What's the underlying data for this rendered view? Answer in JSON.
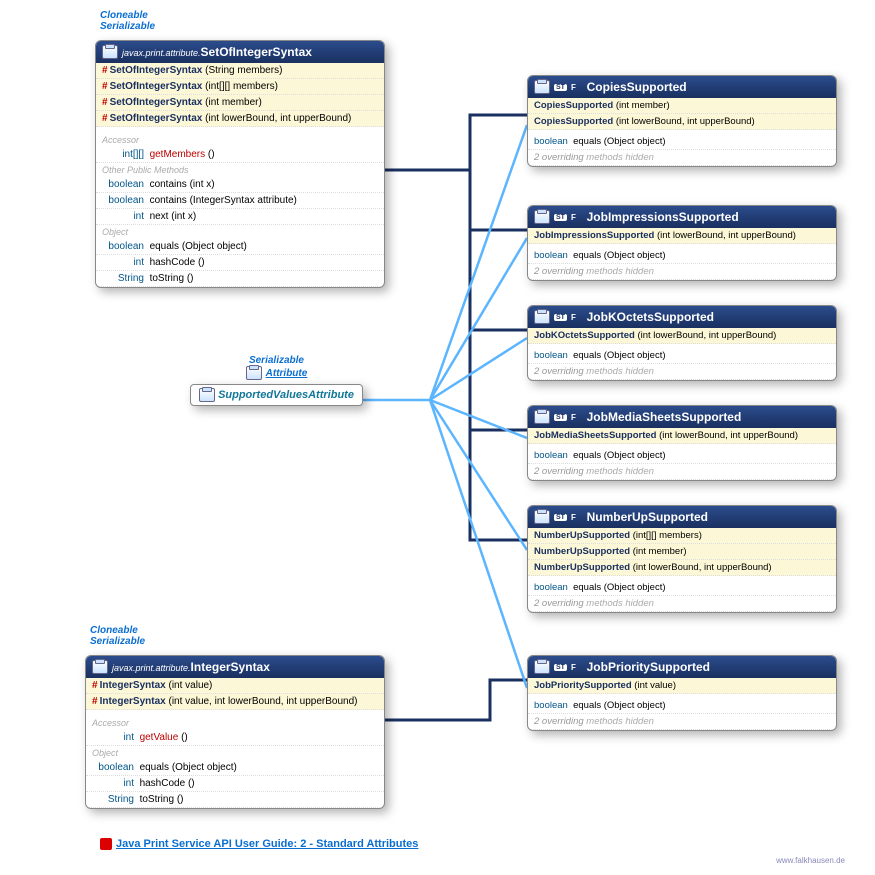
{
  "annot": {
    "cloneable": "Cloneable",
    "serializable": "Serializable",
    "attribute": "Attribute"
  },
  "setOfIntegerSyntax": {
    "pkg": "javax.print.attribute.",
    "title": "SetOfIntegerSyntax",
    "ctors": [
      {
        "name": "SetOfIntegerSyntax",
        "params": "(String members)"
      },
      {
        "name": "SetOfIntegerSyntax",
        "params": "(int[][] members)"
      },
      {
        "name": "SetOfIntegerSyntax",
        "params": "(int member)"
      },
      {
        "name": "SetOfIntegerSyntax",
        "params": "(int lowerBound, int upperBound)"
      }
    ],
    "groups": {
      "accessor": "Accessor",
      "otherPublic": "Other Public Methods",
      "object": "Object"
    },
    "accessor": {
      "ret": "int[][]",
      "name": "getMembers",
      "params": "()"
    },
    "otherMethods": [
      {
        "ret": "boolean",
        "name": "contains",
        "params": "(int x)"
      },
      {
        "ret": "boolean",
        "name": "contains",
        "params": "(IntegerSyntax attribute)"
      },
      {
        "ret": "int",
        "name": "next",
        "params": "(int x)"
      }
    ],
    "objectMethods": [
      {
        "ret": "boolean",
        "name": "equals",
        "params": "(Object object)"
      },
      {
        "ret": "int",
        "name": "hashCode",
        "params": "()"
      },
      {
        "ret": "String",
        "name": "toString",
        "params": "()"
      }
    ]
  },
  "integerSyntax": {
    "pkg": "javax.print.attribute.",
    "title": "IntegerSyntax",
    "ctors": [
      {
        "name": "IntegerSyntax",
        "params": "(int value)"
      },
      {
        "name": "IntegerSyntax",
        "params": "(int value, int lowerBound, int upperBound)"
      }
    ],
    "accessor": {
      "ret": "int",
      "name": "getValue",
      "params": "()"
    },
    "objectMethods": [
      {
        "ret": "boolean",
        "name": "equals",
        "params": "(Object object)"
      },
      {
        "ret": "int",
        "name": "hashCode",
        "params": "()"
      },
      {
        "ret": "String",
        "name": "toString",
        "params": "()"
      }
    ]
  },
  "interfaceBox": {
    "serializable": "Serializable",
    "attribute": "Attribute",
    "title": "SupportedValuesAttribute"
  },
  "subclasses": [
    {
      "title": "CopiesSupported",
      "ctors": [
        {
          "name": "CopiesSupported",
          "params": "(int member)"
        },
        {
          "name": "CopiesSupported",
          "params": "(int lowerBound, int upperBound)"
        }
      ]
    },
    {
      "title": "JobImpressionsSupported",
      "ctors": [
        {
          "name": "JobImpressionsSupported",
          "params": "(int lowerBound, int upperBound)"
        }
      ]
    },
    {
      "title": "JobKOctetsSupported",
      "ctors": [
        {
          "name": "JobKOctetsSupported",
          "params": "(int lowerBound, int upperBound)"
        }
      ]
    },
    {
      "title": "JobMediaSheetsSupported",
      "ctors": [
        {
          "name": "JobMediaSheetsSupported",
          "params": "(int lowerBound, int upperBound)"
        }
      ]
    },
    {
      "title": "NumberUpSupported",
      "ctors": [
        {
          "name": "NumberUpSupported",
          "params": "(int[][] members)"
        },
        {
          "name": "NumberUpSupported",
          "params": "(int member)"
        },
        {
          "name": "NumberUpSupported",
          "params": "(int lowerBound, int upperBound)"
        }
      ]
    },
    {
      "title": "JobPrioritySupported",
      "ctors": [
        {
          "name": "JobPrioritySupported",
          "params": "(int value)"
        }
      ]
    }
  ],
  "common": {
    "equalsRet": "boolean",
    "equalsName": "equals",
    "equalsParams": "(Object object)",
    "hiddenPrefix": "2 overriding",
    "hiddenSuffix": " methods hidden"
  },
  "footer": {
    "link": "Java Print Service API User Guide: 2 - Standard Attributes",
    "credit": "www.falkhausen.de"
  }
}
